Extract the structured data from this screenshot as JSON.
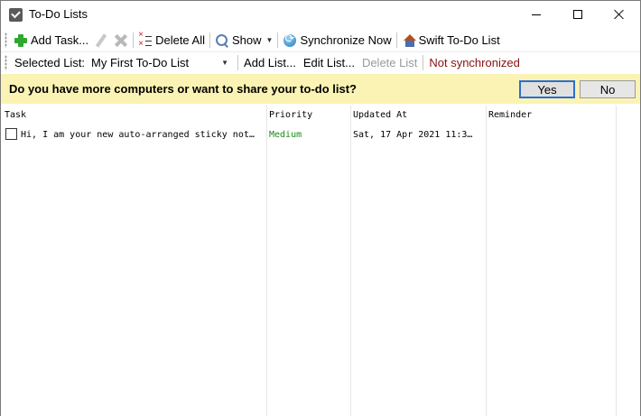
{
  "window": {
    "title": "To-Do Lists",
    "app_icon": "checkbox-app-icon"
  },
  "toolbar": {
    "add_task": "Add Task...",
    "delete_all": "Delete All",
    "show": "Show",
    "sync_now": "Synchronize Now",
    "swift": "Swift To-Do List"
  },
  "listbar": {
    "label": "Selected List:",
    "selected": "My First To-Do List",
    "add_list": "Add List...",
    "edit_list": "Edit List...",
    "delete_list": "Delete List",
    "status": "Not synchronized",
    "status_color": "#8b1010"
  },
  "banner": {
    "message": "Do you have more computers or want to share your to-do list?",
    "yes": "Yes",
    "no": "No",
    "background": "#fbf3b4"
  },
  "table": {
    "headers": [
      "Task",
      "Priority",
      "Updated At",
      "Reminder"
    ],
    "rows": [
      {
        "checked": false,
        "task": "Hi, I am your new auto-arranged sticky not…",
        "priority": "Medium",
        "updated": "Sat, 17 Apr 2021 11:3…",
        "reminder": ""
      }
    ],
    "priority_color": "#1a8a1a"
  }
}
